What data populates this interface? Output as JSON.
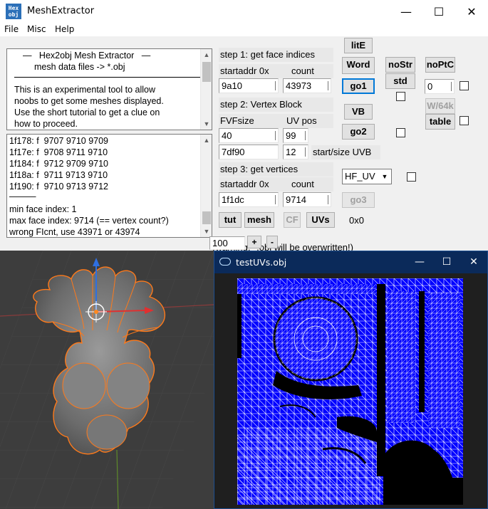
{
  "window": {
    "title": "MeshExtractor",
    "icon_label": "Hex\nobj",
    "controls": {
      "minimize": "—",
      "maximize": "☐",
      "close": "✕"
    }
  },
  "menu": {
    "file": "File",
    "misc": "Misc",
    "help": "Help"
  },
  "intro": {
    "lines": [
      "—   Hex2obj Mesh Extractor   —",
      "mesh data files -> *.obj",
      "This is an experimental tool to allow",
      "noobs to get some meshes displayed.",
      "Use the short tutorial to get a clue on",
      "how to proceed."
    ]
  },
  "log": {
    "lines": [
      "1f178: f  9707 9710 9709",
      "1f17e: f  9708 9711 9710",
      "1f184: f  9712 9709 9710",
      "1f18a: f  9711 9713 9710",
      "1f190: f  9710 9713 9712",
      "———",
      "min face index: 1",
      "max face index: 9714 (== vertex count?)",
      "wrong FIcnt, use 43971 or 43974"
    ]
  },
  "step1": {
    "title": "step 1: get face indices",
    "startaddr_label": "startaddr 0x",
    "count_label": "count",
    "startaddr": "9a10",
    "count": "43973",
    "go_label": "go1"
  },
  "step2": {
    "title": "step 2: Vertex Block",
    "fvf_label": "FVFsize",
    "uvpos_label": "UV pos",
    "fvfsize": "40",
    "uvpos": "99",
    "uvb_start": "7df90",
    "uvb_size": "12",
    "uvb_label": "start/size UVB",
    "vb_label": "VB",
    "go_label": "go2"
  },
  "step3": {
    "title": "step 3: get vertices",
    "startaddr_label": "startaddr 0x",
    "count_label": "count",
    "startaddr": "1f1dc",
    "count": "9714",
    "go_label": "go3",
    "uv_format": "HF_UV"
  },
  "buttons": {
    "lite": "litE",
    "word": "Word",
    "nostr": "noStr",
    "noptc": "noPtC",
    "std": "std",
    "w64k": "W/64k",
    "table": "table",
    "tut": "tut",
    "mesh": "mesh",
    "cf": "CF",
    "uvs": "UVs",
    "plus": "+",
    "minus": "-"
  },
  "fields": {
    "offset": "0",
    "dims": "0x0",
    "scale": "100"
  },
  "warning": "(warning: *.obj will be overwritten!)",
  "uv_window": {
    "title": "testUVs.obj",
    "controls": {
      "minimize": "—",
      "maximize": "☐",
      "close": "✕"
    }
  },
  "colors": {
    "uv_bg": "#0000ff",
    "uv_line": "#ffffff",
    "viewport_bg": "#3d3d3d",
    "mesh_outline": "#ff7a1a",
    "uv_titlebar": "#0b2a5a"
  }
}
